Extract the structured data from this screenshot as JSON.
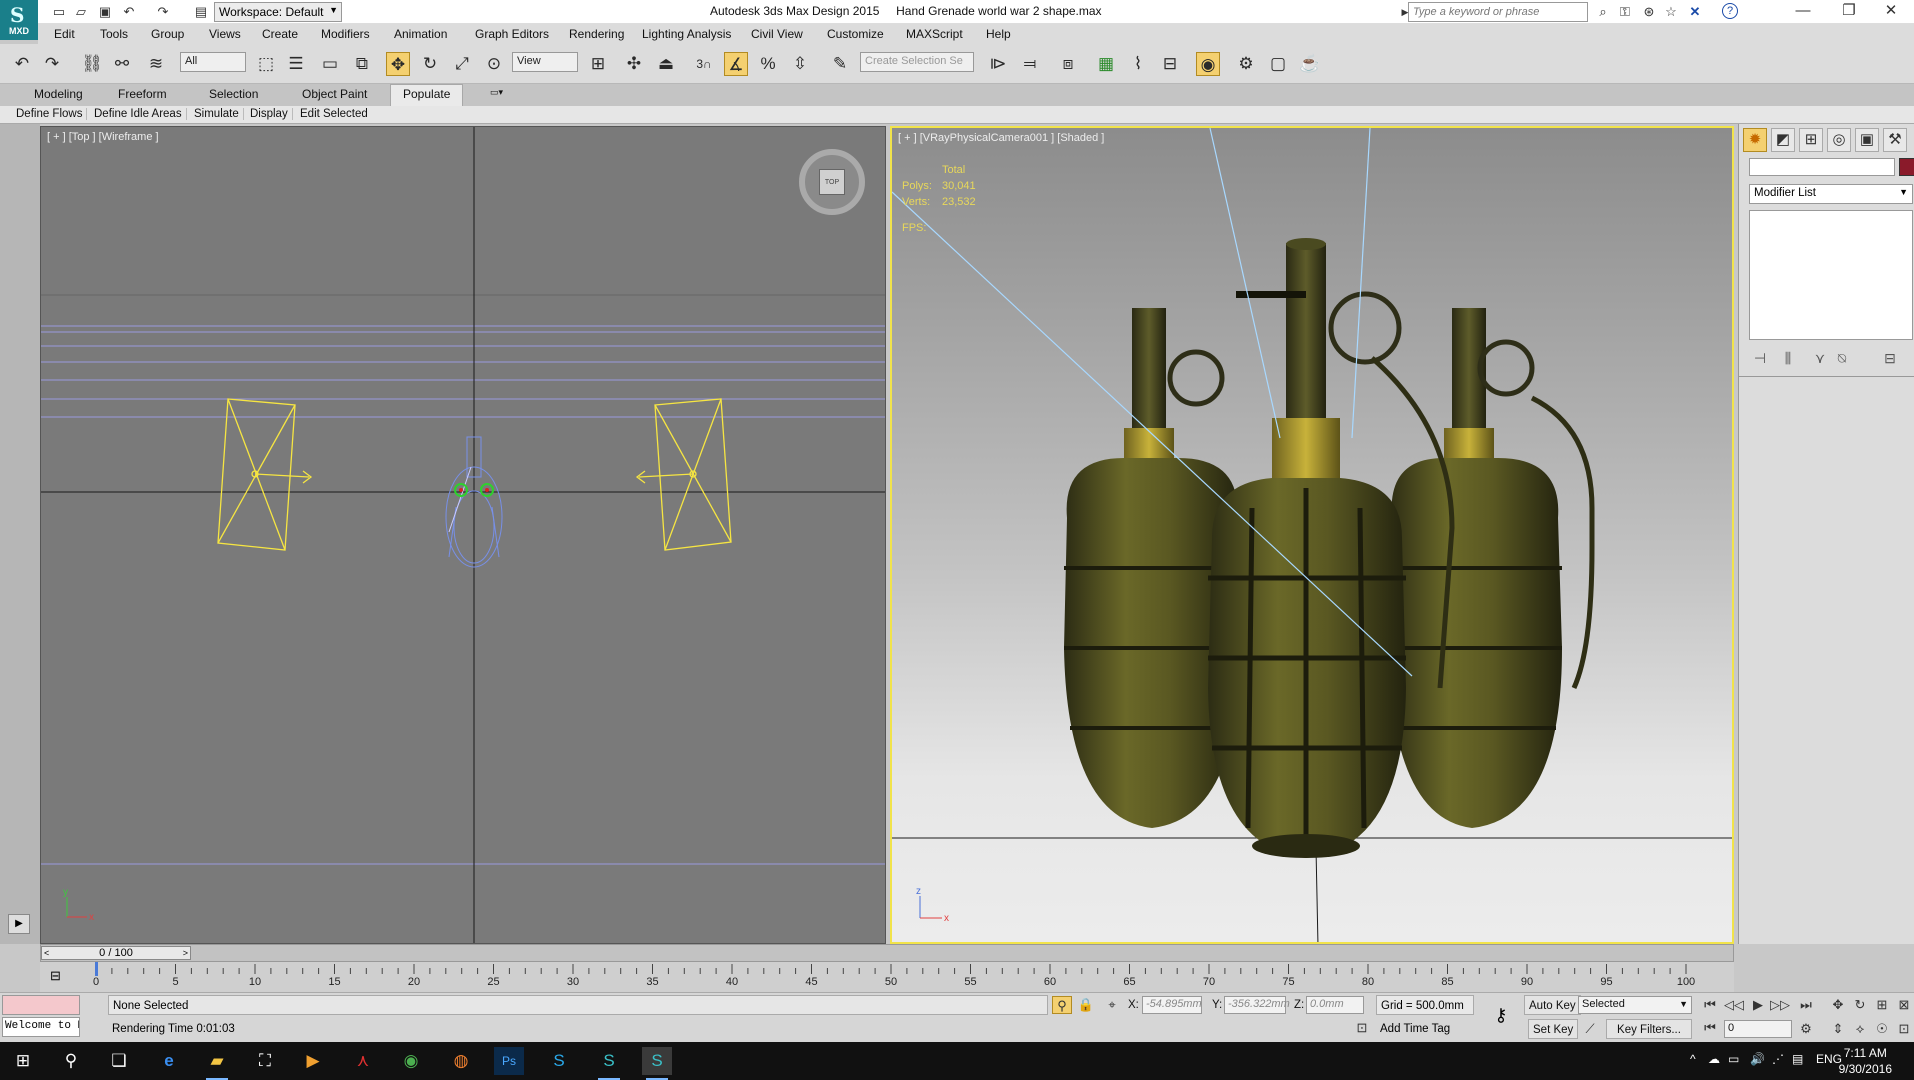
{
  "titlebar": {
    "app_logo_text": "MXD",
    "workspace_label": "Workspace: Default",
    "window_title": "Autodesk 3ds Max Design 2015     Hand Grenade world war 2 shape.max",
    "search_placeholder": "Type a keyword or phrase"
  },
  "menubar": {
    "items": [
      "Edit",
      "Tools",
      "Group",
      "Views",
      "Create",
      "Modifiers",
      "Animation",
      "Graph Editors",
      "Rendering",
      "Lighting Analysis",
      "Civil View",
      "Customize",
      "MAXScript",
      "Help"
    ]
  },
  "toolbar": {
    "selection_filter": "All",
    "ref_coord": "View",
    "snap_number": "3",
    "selection_set_placeholder": "Create Selection Se"
  },
  "ribbon": {
    "tabs": [
      "Modeling",
      "Freeform",
      "Selection",
      "Object Paint",
      "Populate"
    ],
    "active_tab": "Populate",
    "populate_buttons": [
      "Define Flows",
      "Define Idle Areas",
      "Simulate",
      "Display",
      "Edit Selected"
    ]
  },
  "viewport_top": {
    "label": "[ + ] [Top ] [Wireframe ]",
    "viewcube_face": "TOP",
    "axis_y": "y",
    "axis_x": "x",
    "colors": {
      "camera": "#f6e542",
      "grid_lines": "#9999dd",
      "axis": "#1a1a1a"
    }
  },
  "viewport_camera": {
    "label": "[ + ] [VRayPhysicalCamera001 ] [Shaded ]",
    "stats_header": "Total",
    "polys_label": "Polys:",
    "polys_value": "30,041",
    "verts_label": "Verts:",
    "verts_value": "23,532",
    "fps_label": "FPS:",
    "axis_z": "z",
    "axis_x": "x",
    "colors": {
      "border": "#f1e34a",
      "grenade_body": "#5f5e25",
      "grenade_band": "#b6a232"
    }
  },
  "command_panel": {
    "modifier_list": "Modifier List",
    "object_color": "#8a1a2a"
  },
  "time_slider": {
    "position": "0 / 100",
    "ticks": [
      "0",
      "5",
      "10",
      "15",
      "20",
      "25",
      "30",
      "35",
      "40",
      "45",
      "50",
      "55",
      "60",
      "65",
      "70",
      "75",
      "80",
      "85",
      "90",
      "95",
      "100"
    ]
  },
  "statusbar": {
    "maxscript_listener": "Welcome to M",
    "selection_status": "None Selected",
    "rendering_time": "Rendering Time  0:01:03",
    "x_label": "X:",
    "x_value": "-54.895mm",
    "y_label": "Y:",
    "y_value": "-356.322mm",
    "z_label": "Z:",
    "z_value": "0.0mm",
    "grid": "Grid = 500.0mm",
    "add_time_tag": "Add Time Tag",
    "auto_key": "Auto Key",
    "set_key": "Set Key",
    "key_mode": "Selected",
    "key_filters": "Key Filters...",
    "frame": "0"
  },
  "taskbar": {
    "language": "ENG",
    "time": "7:11 AM",
    "date": "9/30/2016"
  }
}
